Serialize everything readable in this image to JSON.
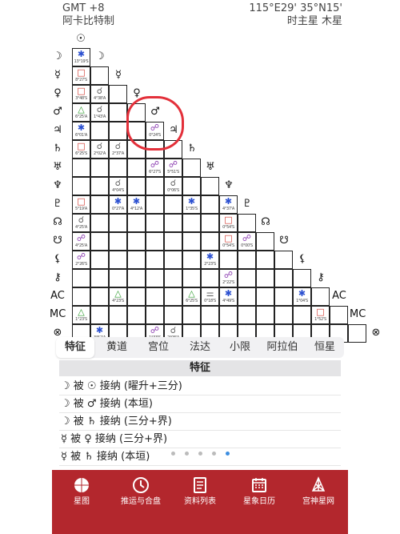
{
  "header": {
    "timezone": "GMT +8",
    "chart_name": "阿卡比特制",
    "location": "115°E29' 35°N15'",
    "house_system": "时主星 木星"
  },
  "planets": [
    "☉",
    "☽",
    "☿",
    "♀",
    "♂",
    "♃",
    "♄",
    "♅",
    "♆",
    "♇",
    "☊",
    "☋",
    "⚸",
    "⚷",
    "AC",
    "MC",
    "⊗"
  ],
  "aspects": [
    {
      "r": 1,
      "c": 0,
      "s": "✱",
      "k": "sex",
      "o": "13°19'S"
    },
    {
      "r": 2,
      "c": 0,
      "s": "□",
      "k": "sq",
      "o": "8°27'S"
    },
    {
      "r": 3,
      "c": 0,
      "s": "□",
      "k": "sq",
      "o": "3°48'S"
    },
    {
      "r": 3,
      "c": 1,
      "s": "☌",
      "k": "conj",
      "o": "4°38'A"
    },
    {
      "r": 4,
      "c": 0,
      "s": "△",
      "k": "tri",
      "o": "6°25'A"
    },
    {
      "r": 4,
      "c": 1,
      "s": "☌",
      "k": "conj",
      "o": "1°43'A"
    },
    {
      "r": 5,
      "c": 0,
      "s": "✱",
      "k": "sex",
      "o": "6°01'A"
    },
    {
      "r": 5,
      "c": 4,
      "s": "☍",
      "k": "sesq",
      "o": "0°24'S"
    },
    {
      "r": 6,
      "c": 0,
      "s": "□",
      "k": "sq",
      "o": "6°25'S"
    },
    {
      "r": 6,
      "c": 1,
      "s": "☌",
      "k": "conj",
      "o": "2°02'A"
    },
    {
      "r": 6,
      "c": 2,
      "s": "☌",
      "k": "conj",
      "o": "2°37'A"
    },
    {
      "r": 7,
      "c": 4,
      "s": "☍",
      "k": "sesq",
      "o": "6°27'S"
    },
    {
      "r": 7,
      "c": 5,
      "s": "☍",
      "k": "sesq",
      "o": "5°51'S"
    },
    {
      "r": 8,
      "c": 2,
      "s": "☌",
      "k": "conj",
      "o": "4°04'S"
    },
    {
      "r": 8,
      "c": 5,
      "s": "☌",
      "k": "conj",
      "o": "0°06'S"
    },
    {
      "r": 9,
      "c": 0,
      "s": "□",
      "k": "sq",
      "o": "5°19'A"
    },
    {
      "r": 9,
      "c": 2,
      "s": "✱",
      "k": "sex",
      "o": "0°27'A"
    },
    {
      "r": 9,
      "c": 3,
      "s": "✱",
      "k": "sex",
      "o": "4°12'A"
    },
    {
      "r": 9,
      "c": 6,
      "s": "✱",
      "k": "sex",
      "o": "1°35'S"
    },
    {
      "r": 9,
      "c": 8,
      "s": "✱",
      "k": "sex",
      "o": "4°37'A"
    },
    {
      "r": 10,
      "c": 0,
      "s": "☌",
      "k": "conj",
      "o": "4°25'A"
    },
    {
      "r": 10,
      "c": 8,
      "s": "□",
      "k": "sq",
      "o": "0°54'S"
    },
    {
      "r": 11,
      "c": 0,
      "s": "☍",
      "k": "sesq",
      "o": "4°25'A"
    },
    {
      "r": 11,
      "c": 8,
      "s": "□",
      "k": "sq",
      "o": "0°54'S"
    },
    {
      "r": 11,
      "c": 9,
      "s": "☍",
      "k": "sesq",
      "o": "0°00'S"
    },
    {
      "r": 12,
      "c": 0,
      "s": "☍",
      "k": "sesq",
      "o": "2°26'S"
    },
    {
      "r": 12,
      "c": 7,
      "s": "✱",
      "k": "sex",
      "o": "2°23'S"
    },
    {
      "r": 13,
      "c": 8,
      "s": "☍",
      "k": "sesq",
      "o": "2°22'S"
    },
    {
      "r": 14,
      "c": 2,
      "s": "△",
      "k": "tri",
      "o": "4°23'S"
    },
    {
      "r": 14,
      "c": 6,
      "s": "△",
      "k": "tri",
      "o": "6°25'S"
    },
    {
      "r": 14,
      "c": 7,
      "s": "⚌",
      "k": "conj",
      "o": "0°18'S"
    },
    {
      "r": 14,
      "c": 8,
      "s": "✱",
      "k": "sex",
      "o": "4°49'S"
    },
    {
      "r": 14,
      "c": 12,
      "s": "✱",
      "k": "sex",
      "o": "1°04'S"
    },
    {
      "r": 15,
      "c": 0,
      "s": "△",
      "k": "tri",
      "o": "1°23'S"
    },
    {
      "r": 15,
      "c": 13,
      "s": "□",
      "k": "sq",
      "o": "1°52'S"
    },
    {
      "r": 16,
      "c": 1,
      "s": "✱",
      "k": "sex",
      "o": "3°52'A"
    },
    {
      "r": 16,
      "c": 4,
      "s": "☍",
      "k": "sesq",
      "o": "1°33'S"
    },
    {
      "r": 16,
      "c": 5,
      "s": "☌",
      "k": "conj",
      "o": "2°08'A"
    }
  ],
  "tabs": [
    "特征",
    "黄道",
    "宫位",
    "法达",
    "小限",
    "阿拉伯",
    "恒星"
  ],
  "active_tab": "特征",
  "panel": {
    "title": "特征",
    "rows": [
      "☽ 被 ☉ 接纳 (曜升+三分)",
      "☽ 被 ♂ 接纳 (本垣)",
      "☽ 被 ♄ 接纳 (三分+界)",
      "☿ 被 ♀ 接纳 (三分+界)",
      "☿ 被 ♄ 接纳 (本垣)"
    ]
  },
  "pagination": {
    "pages": 5,
    "active": 5
  },
  "nav": [
    {
      "label": "星图",
      "icon": "chart-wheel-icon"
    },
    {
      "label": "推运与合盘",
      "icon": "clock-icon"
    },
    {
      "label": "资料列表",
      "icon": "document-list-icon"
    },
    {
      "label": "星象日历",
      "icon": "calendar-icon"
    },
    {
      "label": "宫神星网",
      "icon": "network-icon"
    }
  ]
}
